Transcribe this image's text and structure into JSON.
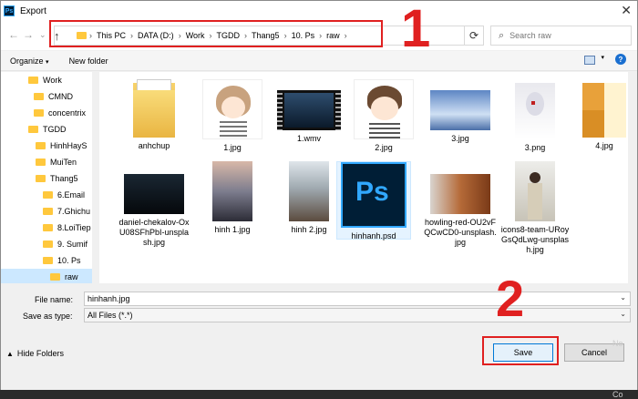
{
  "window": {
    "title": "Export",
    "app_icon": "Ps"
  },
  "address_bar": {
    "crumbs": [
      "This PC",
      "DATA (D:)",
      "Work",
      "TGDD",
      "Thang5",
      "10. Ps",
      "raw"
    ],
    "search_placeholder": "Search raw"
  },
  "annotations": {
    "step1": "1",
    "step2": "2",
    "accent": "#e02020"
  },
  "toolbar": {
    "organize": "Organize",
    "new_folder": "New folder"
  },
  "sidebar": {
    "items": [
      {
        "label": "Work"
      },
      {
        "label": "CMND"
      },
      {
        "label": "concentrix"
      },
      {
        "label": "TGDD"
      },
      {
        "label": "HinhHayS"
      },
      {
        "label": "MuiTen"
      },
      {
        "label": "Thang5"
      },
      {
        "label": "6.Email"
      },
      {
        "label": "7.Ghichu"
      },
      {
        "label": "8.LoiTiep"
      },
      {
        "label": "9. Sumif"
      },
      {
        "label": "10. Ps"
      },
      {
        "label": "raw"
      }
    ]
  },
  "files": [
    {
      "name": "anhchup",
      "kind": "folder"
    },
    {
      "name": "1.jpg",
      "kind": "girl"
    },
    {
      "name": "1.wmv",
      "kind": "video"
    },
    {
      "name": "2.jpg",
      "kind": "boy"
    },
    {
      "name": "3.jpg",
      "kind": "sky"
    },
    {
      "name": "3.png",
      "kind": "anime"
    },
    {
      "name": "4.jpg",
      "kind": "meme"
    },
    {
      "name": "daniel-chekalov-OxU08SFhPbI-unsplash.jpg",
      "kind": "dark"
    },
    {
      "name": "hinh 1.jpg",
      "kind": "sunset"
    },
    {
      "name": "hinh 2.jpg",
      "kind": "mountain"
    },
    {
      "name": "hinhanh.psd",
      "kind": "psd"
    },
    {
      "name": "howling-red-OU2vFQCwCD0-unsplash.jpg",
      "kind": "fox"
    },
    {
      "name": "icons8-team-URoyGsQdLwg-unsplash.jpg",
      "kind": "woman"
    }
  ],
  "form": {
    "file_name_label": "File name:",
    "file_name_value": "hinhanh.jpg",
    "save_type_label": "Save as type:",
    "save_type_value": "All Files (*.*)"
  },
  "buttons": {
    "save": "Save",
    "cancel": "Cancel",
    "hide_folders": "Hide Folders"
  },
  "background_right": {
    "line1": "No",
    "line2": "Co"
  }
}
